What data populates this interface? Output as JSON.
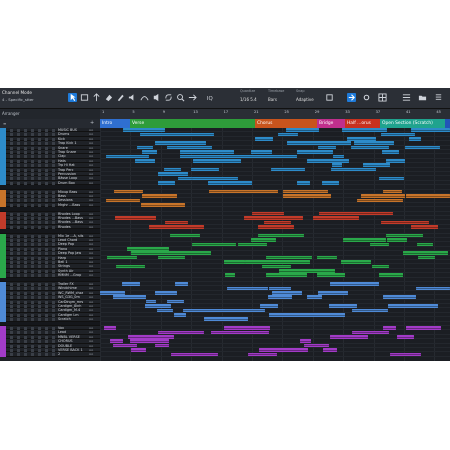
{
  "toolbar": {
    "channel_mode": "Channel Mode",
    "song_sub": "4 - Specific_stter",
    "quantize_label": "Quantize",
    "quantize_value": "1/16 5.4",
    "timebase_label": "Timebase",
    "timebase_value": "Bars",
    "snap_label": "Snap",
    "snap_value": "Adaptive",
    "icons": [
      "arrow-tool-icon",
      "range-tool-icon",
      "split-tool-icon",
      "eraser-tool-icon",
      "paint-tool-icon",
      "mute-tool-icon",
      "bend-tool-icon",
      "listen-tool-icon",
      "loop-icon",
      "zoom-icon",
      "autoscroll-icon",
      "iq-icon",
      "snap-icon",
      "edit-icon",
      "settings-icon",
      "grid-icon",
      "browse-icon",
      "folder-icon",
      "list-icon"
    ]
  },
  "arranger": {
    "label": "Arranger"
  },
  "ruler": {
    "ticks": [
      "1",
      "5",
      "9",
      "13",
      "17",
      "21",
      "25",
      "29",
      "33",
      "37",
      "41",
      "45"
    ]
  },
  "markers": [
    {
      "label": "Intro",
      "color": "#2f6fd0"
    },
    {
      "label": "Verse",
      "color": "#2e9c3a"
    },
    {
      "label": "Chorus",
      "color": "#c8541d"
    },
    {
      "label": "Bridge",
      "color": "#c02f8c"
    },
    {
      "label": "Half ...orus",
      "color": "#c7311f"
    },
    {
      "label": "Open Section (Scratch)",
      "color": "#1fa38e"
    },
    {
      "label": "",
      "color": "#2255b8"
    }
  ],
  "tracks": [
    {
      "name": "MUSIC BUS",
      "color": "#2d8bc9",
      "aa": "AA"
    },
    {
      "name": "Drums",
      "color": "#2d8bc9",
      "aa": "AA"
    },
    {
      "name": "Kick",
      "color": "#2d8bc9",
      "aa": "AA"
    },
    {
      "name": "Trap Kick 1",
      "color": "#2d8bc9",
      "aa": "AA"
    },
    {
      "name": "Snare",
      "color": "#2d8bc9",
      "aa": "AA"
    },
    {
      "name": "Trap Snare",
      "color": "#2d8bc9",
      "aa": "AA"
    },
    {
      "name": "Clap",
      "color": "#2d8bc9",
      "aa": "AA"
    },
    {
      "name": "Hats",
      "color": "#2d8bc9",
      "aa": "AA"
    },
    {
      "name": "Trp Hi Hat",
      "color": "#2d8bc9",
      "aa": "AA"
    },
    {
      "name": "Trap Perc",
      "color": "#2d8bc9",
      "aa": "AA"
    },
    {
      "name": "Percussion",
      "color": "#2d8bc9",
      "aa": "AA"
    },
    {
      "name": "Bässe Loop",
      "color": "#2d8bc9",
      "aa": "AA"
    },
    {
      "name": "Drum Box",
      "color": "#2d8bc9",
      "aa": "AA"
    },
    {
      "name": "",
      "color": "#1d2025",
      "aa": ""
    },
    {
      "name": "Mixup Bass",
      "color": "#c7742a",
      "aa": "AA"
    },
    {
      "name": "Bass",
      "color": "#c7742a",
      "aa": "AA"
    },
    {
      "name": "Sessions",
      "color": "#c7742a",
      "aa": "AA"
    },
    {
      "name": "Mrghr ...Bass",
      "color": "#c7742a",
      "aa": "AA"
    },
    {
      "name": "",
      "color": "#1d2025",
      "aa": ""
    },
    {
      "name": "Rhodes Loop",
      "color": "#c23b2a",
      "aa": "AA"
    },
    {
      "name": "Rhodes ...Bass",
      "color": "#c23b2a",
      "aa": "AA"
    },
    {
      "name": "Rhodes ...Bass",
      "color": "#c23b2a",
      "aa": "AA"
    },
    {
      "name": "Rhodes",
      "color": "#c23b2a",
      "aa": "AA"
    },
    {
      "name": "",
      "color": "#1d2025",
      "aa": ""
    },
    {
      "name": "Mix 1e ...A, sils",
      "color": "#2aa84a",
      "aa": "AA"
    },
    {
      "name": "Lead Chord",
      "color": "#2aa84a",
      "aa": "AA"
    },
    {
      "name": "Deep Pop",
      "color": "#2aa84a",
      "aa": "AA"
    },
    {
      "name": "Piano",
      "color": "#2aa84a",
      "aa": "AA"
    },
    {
      "name": "Deep Pop Jaw",
      "color": "#2aa84a",
      "aa": "AA"
    },
    {
      "name": "Harp",
      "color": "#2aa84a",
      "aa": "AA"
    },
    {
      "name": "Bell 1",
      "color": "#2aa84a",
      "aa": "AA"
    },
    {
      "name": "Strings",
      "color": "#2aa84a",
      "aa": "AA"
    },
    {
      "name": "Synth Air",
      "color": "#2aa84a",
      "aa": "AA"
    },
    {
      "name": "RMNM ...Grop",
      "color": "#2aa84a",
      "aa": "AA"
    },
    {
      "name": "",
      "color": "#1d2025",
      "aa": ""
    },
    {
      "name": "Trailer FX",
      "color": "#4f8ad6",
      "aa": "AA"
    },
    {
      "name": "Windchime",
      "color": "#4f8ad6",
      "aa": "AA"
    },
    {
      "name": "WC_RWM_chzz",
      "color": "#4f8ad6",
      "aa": "AA"
    },
    {
      "name": "WS_G3G_0m",
      "color": "#4f8ad6",
      "aa": "AA"
    },
    {
      "name": "CarDingm_mrs",
      "color": "#4f8ad6",
      "aa": "AA"
    },
    {
      "name": "Cardigm_8inh",
      "color": "#4f8ad6",
      "aa": "AA"
    },
    {
      "name": "Cardigm_M.4",
      "color": "#4f8ad6",
      "aa": "AA"
    },
    {
      "name": "Cardigm Lm",
      "color": "#4f8ad6",
      "aa": "AA"
    },
    {
      "name": "Scratch",
      "color": "#4f8ad6",
      "aa": "AA"
    },
    {
      "name": "",
      "color": "#1d2025",
      "aa": ""
    },
    {
      "name": "Vox",
      "color": "#a23bc7",
      "aa": "AA"
    },
    {
      "name": "Lead",
      "color": "#a23bc7",
      "aa": "AA"
    },
    {
      "name": "MNBL VERSE",
      "color": "#a23bc7",
      "aa": "AA"
    },
    {
      "name": "CHORUS",
      "color": "#a23bc7",
      "aa": "AA"
    },
    {
      "name": "DOUBLE",
      "color": "#a23bc7",
      "aa": "AA"
    },
    {
      "name": "VERSE BACK 1",
      "color": "#a23bc7",
      "aa": "AA"
    },
    {
      "name": "2",
      "color": "#a23bc7",
      "aa": "AA"
    }
  ]
}
